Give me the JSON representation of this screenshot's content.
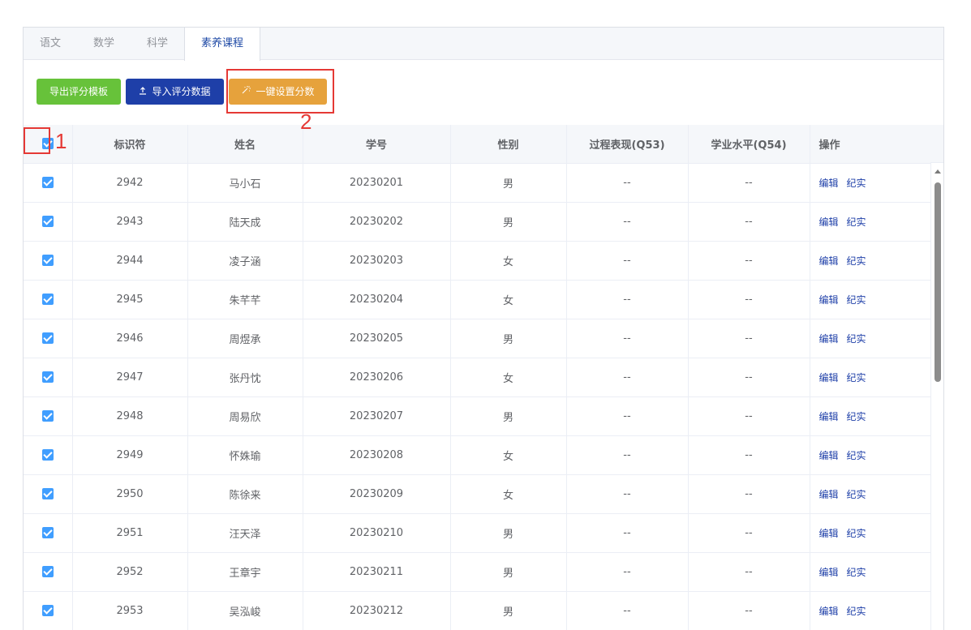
{
  "tabs": [
    {
      "label": "语文",
      "active": false
    },
    {
      "label": "数学",
      "active": false
    },
    {
      "label": "科学",
      "active": false
    },
    {
      "label": "素养课程",
      "active": true
    }
  ],
  "toolbar": {
    "export_label": "导出评分模板",
    "import_label": "导入评分数据",
    "set_score_label": "一键设置分数"
  },
  "table": {
    "headers": {
      "id": "标识符",
      "name": "姓名",
      "student_no": "学号",
      "gender": "性别",
      "process": "过程表现(Q53)",
      "academic": "学业水平(Q54)",
      "ops": "操作"
    },
    "edit_label": "编辑",
    "record_label": "纪实",
    "rows": [
      {
        "id": "2942",
        "name": "马小石",
        "student_no": "20230201",
        "gender": "男",
        "process": "--",
        "academic": "--"
      },
      {
        "id": "2943",
        "name": "陆天成",
        "student_no": "20230202",
        "gender": "男",
        "process": "--",
        "academic": "--"
      },
      {
        "id": "2944",
        "name": "凌子涵",
        "student_no": "20230203",
        "gender": "女",
        "process": "--",
        "academic": "--"
      },
      {
        "id": "2945",
        "name": "朱芊芊",
        "student_no": "20230204",
        "gender": "女",
        "process": "--",
        "academic": "--"
      },
      {
        "id": "2946",
        "name": "周煜承",
        "student_no": "20230205",
        "gender": "男",
        "process": "--",
        "academic": "--"
      },
      {
        "id": "2947",
        "name": "张丹忱",
        "student_no": "20230206",
        "gender": "女",
        "process": "--",
        "academic": "--"
      },
      {
        "id": "2948",
        "name": "周易欣",
        "student_no": "20230207",
        "gender": "男",
        "process": "--",
        "academic": "--"
      },
      {
        "id": "2949",
        "name": "怀姝瑜",
        "student_no": "20230208",
        "gender": "女",
        "process": "--",
        "academic": "--"
      },
      {
        "id": "2950",
        "name": "陈徐来",
        "student_no": "20230209",
        "gender": "女",
        "process": "--",
        "academic": "--"
      },
      {
        "id": "2951",
        "name": "汪天泽",
        "student_no": "20230210",
        "gender": "男",
        "process": "--",
        "academic": "--"
      },
      {
        "id": "2952",
        "name": "王章宇",
        "student_no": "20230211",
        "gender": "男",
        "process": "--",
        "academic": "--"
      },
      {
        "id": "2953",
        "name": "吴泓峻",
        "student_no": "20230212",
        "gender": "男",
        "process": "--",
        "academic": "--"
      }
    ]
  },
  "annotations": {
    "label_1": "1",
    "label_2": "2",
    "color": "#e53935"
  },
  "colors": {
    "primary_blue": "#1e3fa8",
    "success_green": "#67c23a",
    "warning_orange": "#e6a23c",
    "checkbox_blue": "#409eff"
  }
}
